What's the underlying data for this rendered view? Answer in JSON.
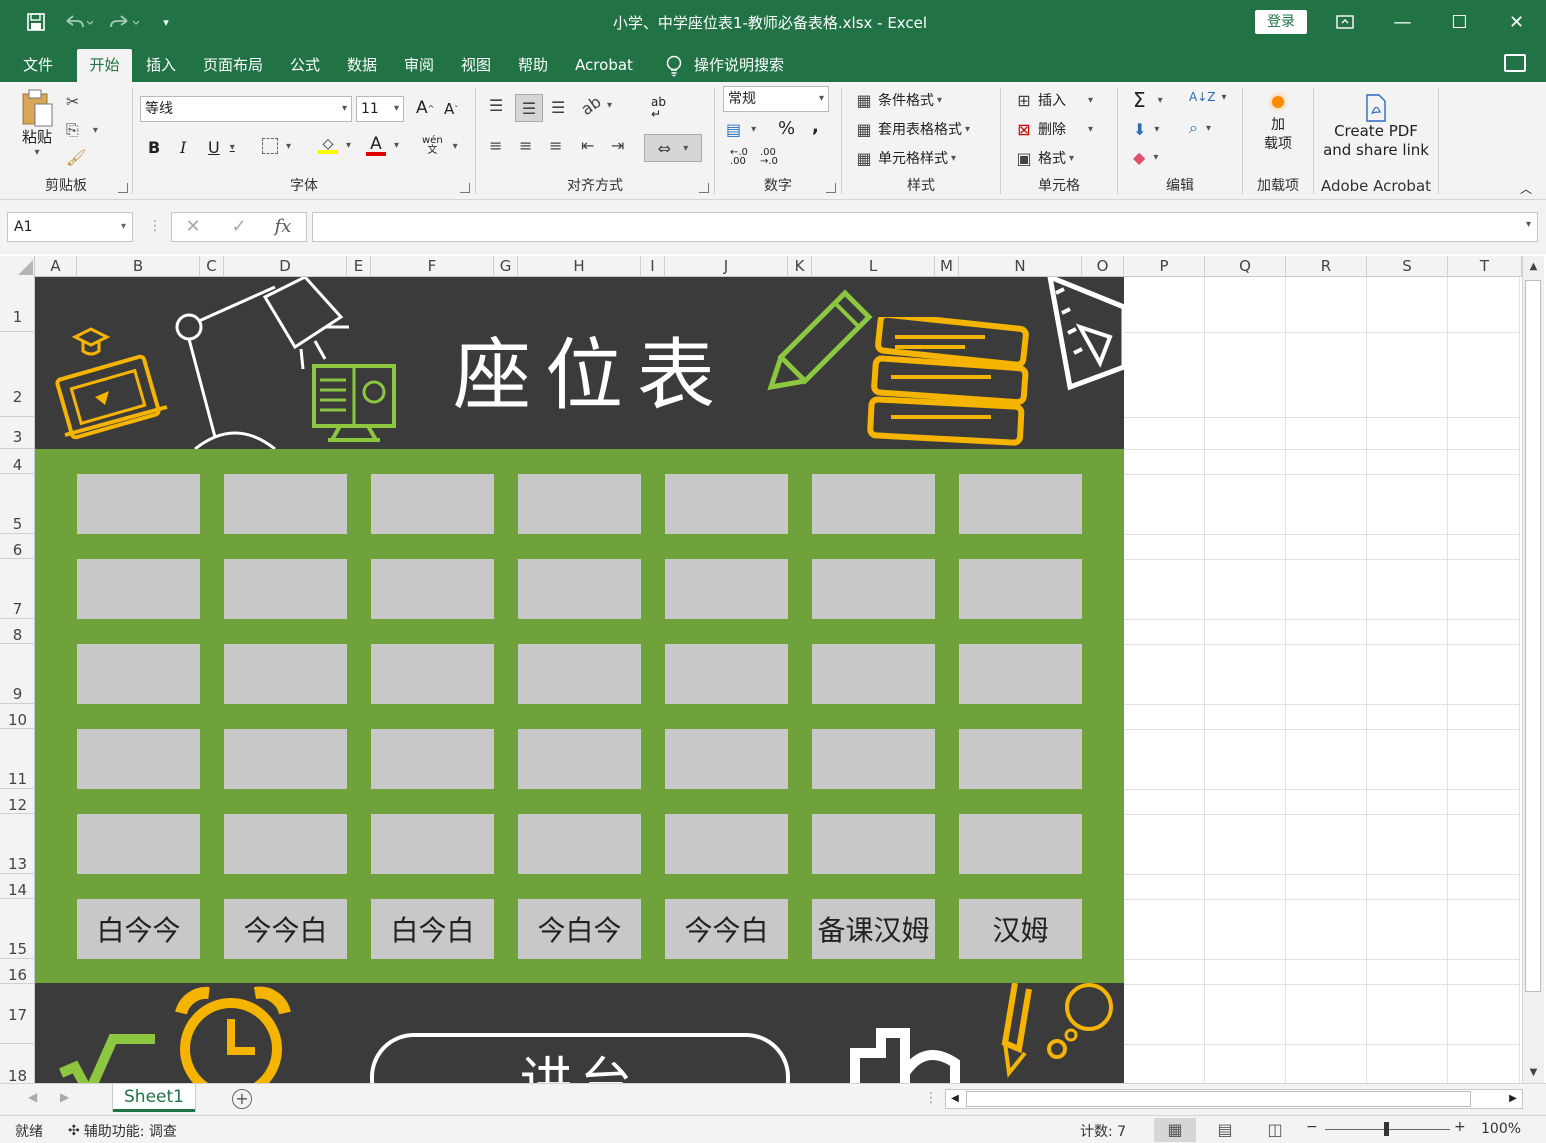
{
  "window": {
    "title": "小学、中学座位表1-教师必备表格.xlsx  -  Excel",
    "login_label": "登录",
    "qa": {
      "save": "save-icon",
      "undo": "undo-icon",
      "redo": "redo-icon",
      "customize": "customize-icon"
    },
    "controls": {
      "ribbon_display": "ribbon-display-icon",
      "minimize": "—",
      "maximize": "☐",
      "close": "✕"
    }
  },
  "tabs": [
    "文件",
    "开始",
    "插入",
    "页面布局",
    "公式",
    "数据",
    "审阅",
    "视图",
    "帮助",
    "Acrobat"
  ],
  "active_tab": "开始",
  "tell_me": "操作说明搜索",
  "ribbon": {
    "clipboard": {
      "label": "剪贴板",
      "paste": "粘贴"
    },
    "font": {
      "label": "字体",
      "font_name": "等线",
      "font_size": "11",
      "bold": "B",
      "italic": "I",
      "underline": "U",
      "font_color_glyph": "A",
      "wen": "wén",
      "grow": "A",
      "shrink": "A"
    },
    "alignment": {
      "label": "对齐方式"
    },
    "number": {
      "label": "数字",
      "format": "常规",
      "percent": "%",
      "comma": ","
    },
    "styles": {
      "label": "样式",
      "conditional": "条件格式",
      "table": "套用表格格式",
      "cell_styles": "单元格样式"
    },
    "cells": {
      "label": "单元格",
      "insert": "插入",
      "delete": "删除",
      "format": "格式"
    },
    "editing": {
      "label": "编辑",
      "sigma": "Σ"
    },
    "addins": {
      "label": "加载项",
      "button": "加\n载项"
    },
    "acrobat": {
      "label": "Adobe Acrobat",
      "line1": "Create PDF",
      "line2": "and share link"
    }
  },
  "formula_bar": {
    "name_box": "A1",
    "fx": "fx",
    "value": ""
  },
  "columns": [
    "A",
    "B",
    "C",
    "D",
    "E",
    "F",
    "G",
    "H",
    "I",
    "J",
    "K",
    "L",
    "M",
    "N",
    "O",
    "P",
    "Q",
    "R",
    "S",
    "T"
  ],
  "rows": [
    "1",
    "2",
    "3",
    "4",
    "5",
    "6",
    "7",
    "8",
    "9",
    "10",
    "11",
    "12",
    "13",
    "14",
    "15",
    "16",
    "17",
    "18"
  ],
  "seat_chart": {
    "title": "座位表",
    "podium": "讲台",
    "last_row": [
      "白今今",
      "今今白",
      "白今白",
      "今白今",
      "今今白",
      "备课汉姆",
      "汉姆"
    ],
    "colors": {
      "chalkboard": "#3b3b3b",
      "green": "#70a23c",
      "seat": "#c8c8c8",
      "yellow": "#f5b400",
      "lime": "#8dc63f"
    }
  },
  "sheets": [
    "Sheet1"
  ],
  "status": {
    "ready": "就绪",
    "accessibility": "辅助功能: 调查",
    "count": "计数: 7",
    "zoom": "100%"
  }
}
